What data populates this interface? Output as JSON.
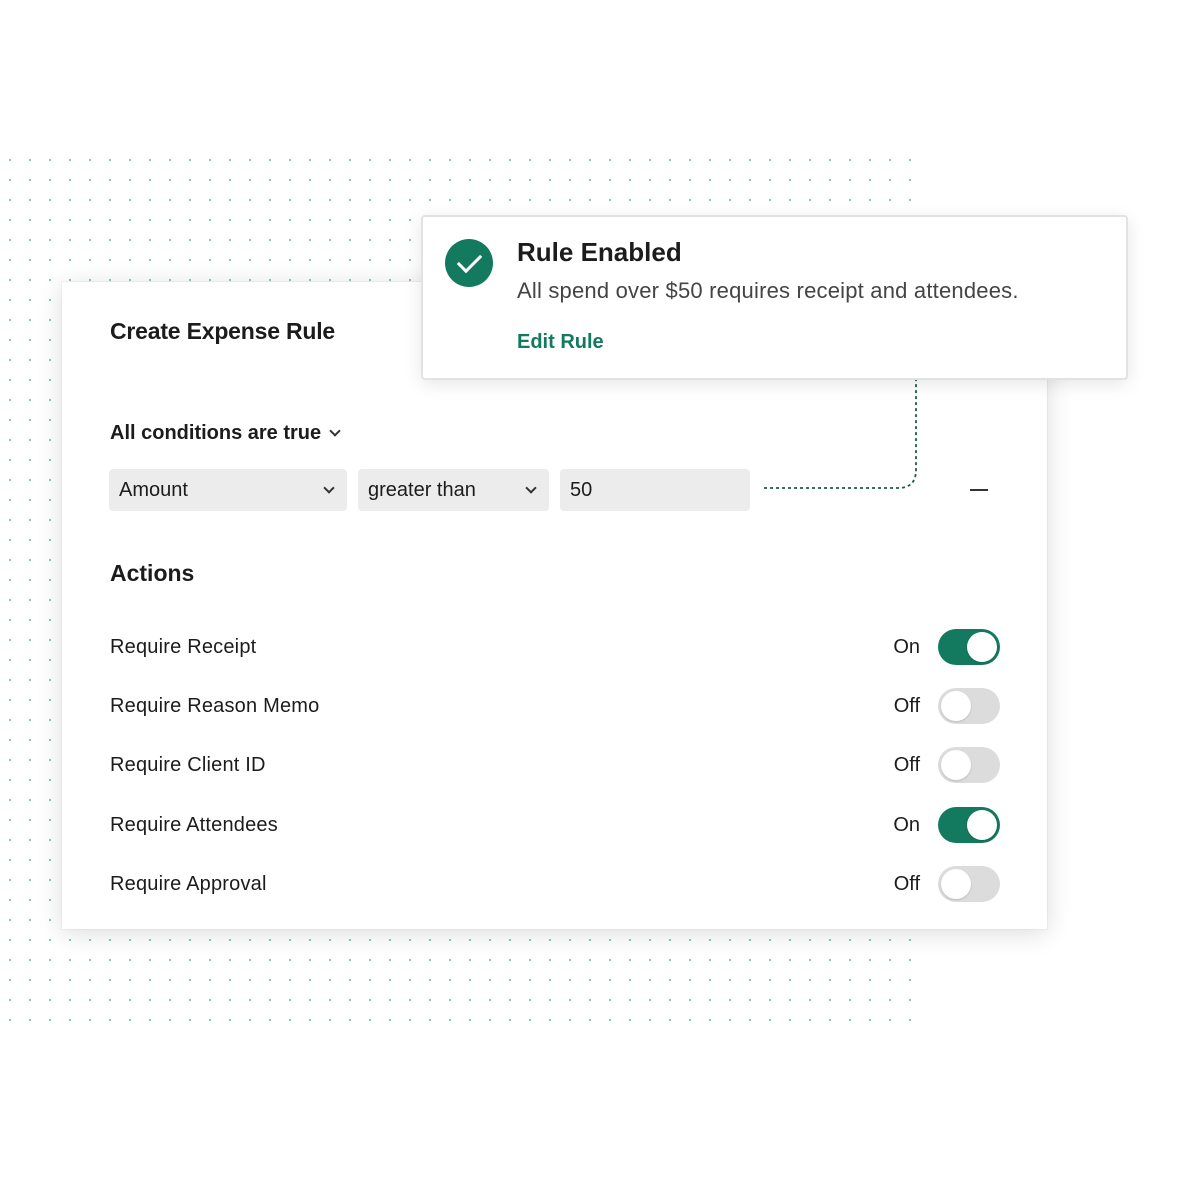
{
  "colors": {
    "accent": "#137a5f",
    "toggle_off": "#dcdcdc",
    "field_bg": "#ececec",
    "dot_pattern": "#8fc4b2"
  },
  "card": {
    "title": "Create Expense Rule",
    "condition_mode": "All conditions are true",
    "condition": {
      "field": "Amount",
      "operator": "greater than",
      "value": "50"
    },
    "actions_title": "Actions",
    "actions": [
      {
        "label": "Require Receipt",
        "state": "On",
        "enabled": true
      },
      {
        "label": "Require Reason Memo",
        "state": "Off",
        "enabled": false
      },
      {
        "label": "Require Client ID",
        "state": "Off",
        "enabled": false
      },
      {
        "label": "Require Attendees",
        "state": "On",
        "enabled": true
      },
      {
        "label": "Require Approval",
        "state": "Off",
        "enabled": false
      }
    ]
  },
  "toast": {
    "icon": "check-circle-icon",
    "title": "Rule Enabled",
    "message": "All spend over $50 requires receipt and attendees.",
    "link": "Edit Rule"
  }
}
